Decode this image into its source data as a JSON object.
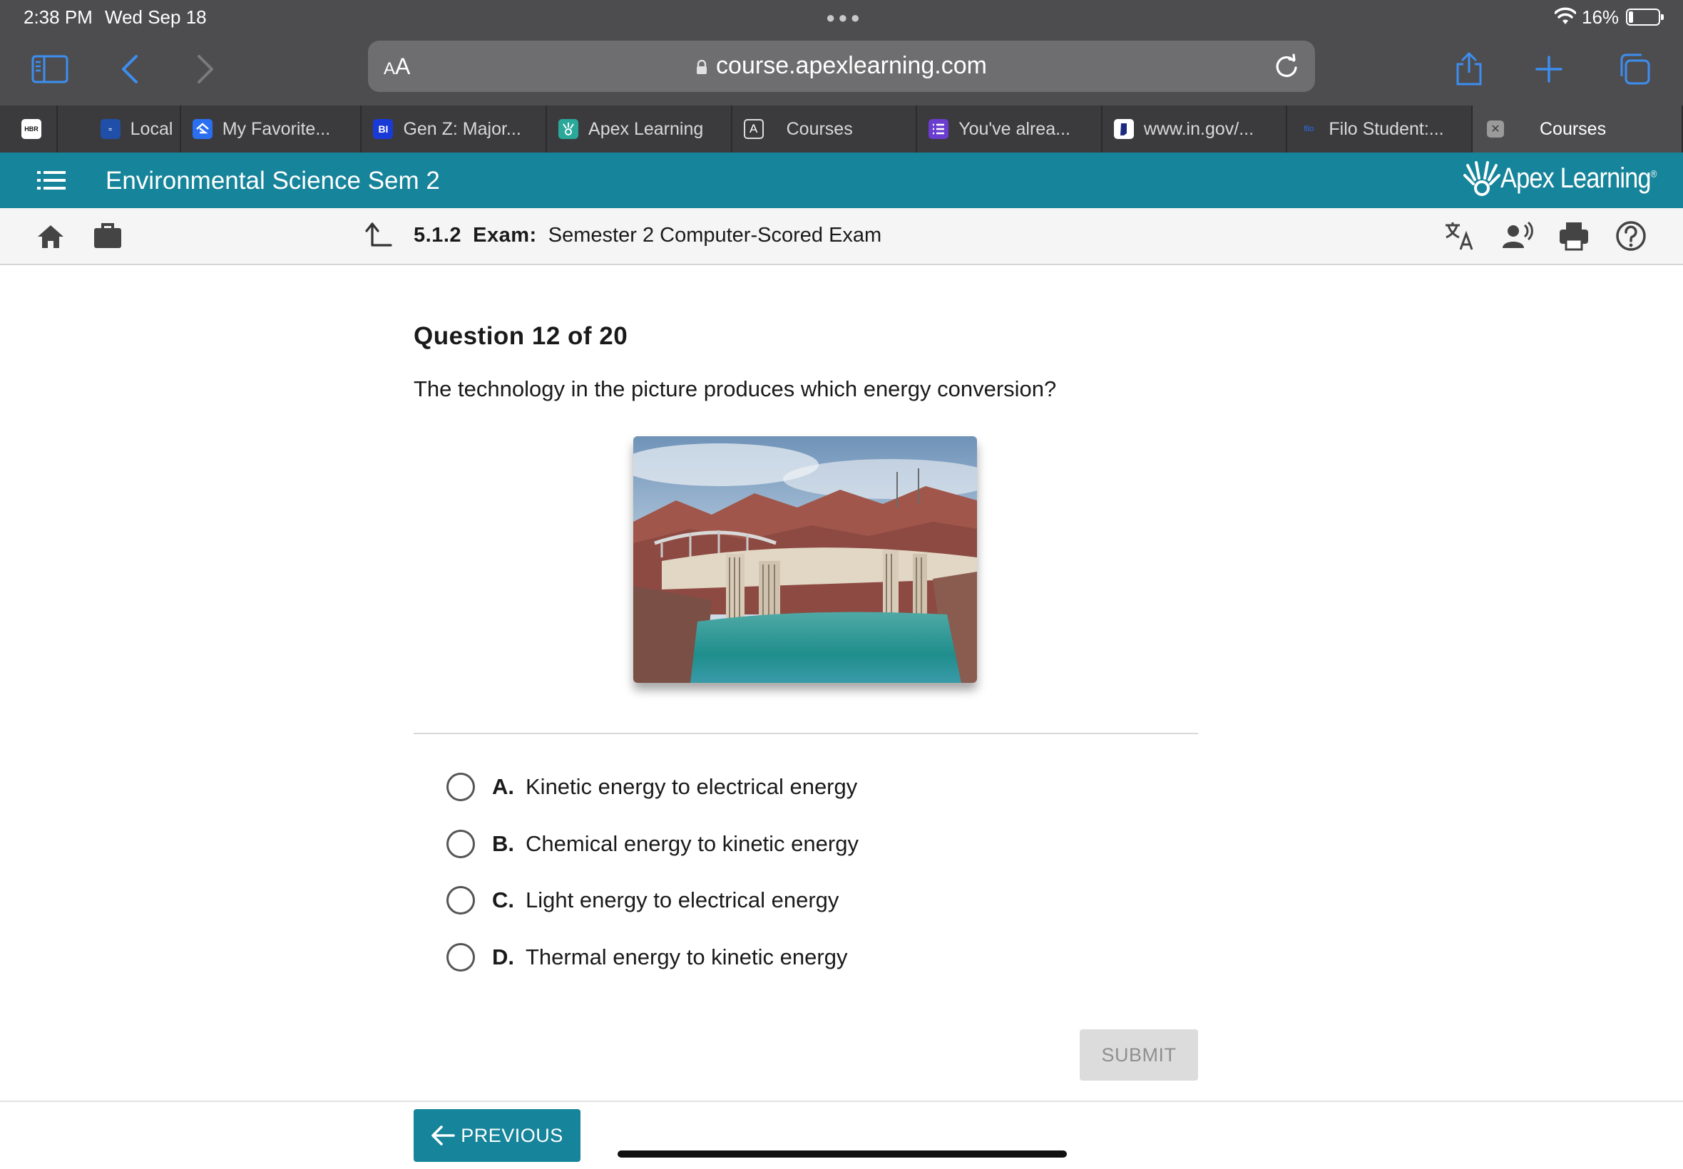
{
  "status_bar": {
    "time": "2:38 PM",
    "date": "Wed Sep 18",
    "battery_pct": "16%",
    "battery_level": 0.16
  },
  "browser": {
    "text_size_label": "AA",
    "url": "course.apexlearning.com"
  },
  "tabs": [
    {
      "label": "",
      "icon": "hbr-icon",
      "fav_text": "HBR",
      "fav_color": "#ffffff"
    },
    {
      "label": "Local",
      "icon": "news-icon",
      "fav_text": "",
      "fav_color": "#1f4fa8"
    },
    {
      "label": "My Favorite...",
      "icon": "zillow-icon",
      "fav_text": "",
      "fav_color": "#2a6ff0"
    },
    {
      "label": "Gen Z: Major...",
      "icon": "business-insider-icon",
      "fav_text": "BI",
      "fav_color": "#1a3ad8"
    },
    {
      "label": "Apex Learning",
      "icon": "apex-icon",
      "fav_text": "",
      "fav_color": "#2aa89a"
    },
    {
      "label": "Courses",
      "icon": "a-letter-icon",
      "fav_text": "A",
      "fav_color": "#3b3b3d"
    },
    {
      "label": "You've alrea...",
      "icon": "list-icon",
      "fav_text": "",
      "fav_color": "#6a3ccf"
    },
    {
      "label": "www.in.gov/...",
      "icon": "indiana-icon",
      "fav_text": "",
      "fav_color": "#ffffff"
    },
    {
      "label": "Filo Student:...",
      "icon": "filo-icon",
      "fav_text": "filo",
      "fav_color": "#3b3b3d"
    },
    {
      "label": "Courses",
      "icon": "close-tab-icon",
      "fav_text": "✕",
      "fav_color": "#9a9a9a"
    }
  ],
  "app": {
    "course_title": "Environmental Science Sem 2",
    "brand": "Apex Learning",
    "brand_color": "#16849a"
  },
  "breadcrumb": {
    "section": "5.1.2",
    "type": "Exam:",
    "name": "Semester 2 Computer-Scored Exam"
  },
  "question": {
    "title": "Question 12 of 20",
    "prompt": "The technology in the picture produces which energy conversion?",
    "image_subject": "hydroelectric-dam",
    "options": [
      {
        "letter": "A.",
        "text": "Kinetic energy to electrical energy"
      },
      {
        "letter": "B.",
        "text": "Chemical energy to kinetic energy"
      },
      {
        "letter": "C.",
        "text": "Light energy to electrical energy"
      },
      {
        "letter": "D.",
        "text": "Thermal energy to kinetic energy"
      }
    ]
  },
  "actions": {
    "submit_label": "SUBMIT",
    "previous_label": "PREVIOUS"
  }
}
